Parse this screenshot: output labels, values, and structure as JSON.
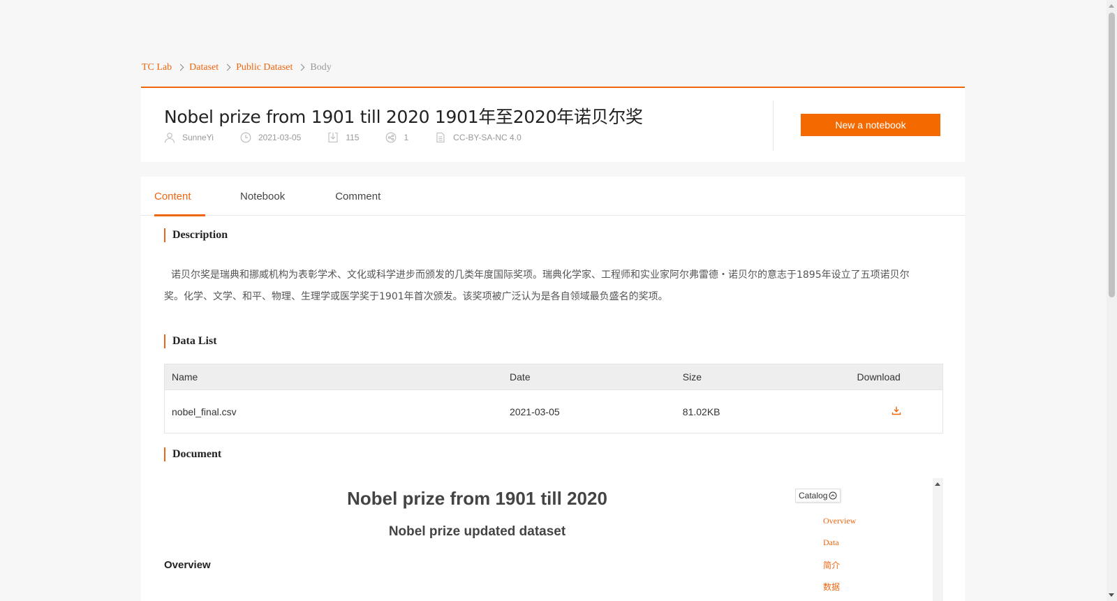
{
  "breadcrumb": {
    "items": [
      "TC Lab",
      "Dataset",
      "Public Dataset"
    ],
    "current": "Body"
  },
  "header": {
    "title": "Nobel prize from 1901 till 2020 1901年至2020年诺贝尔奖",
    "author": "SunneYi",
    "date": "2021-03-05",
    "downloads": "115",
    "forks": "1",
    "license": "CC-BY-SA-NC 4.0",
    "new_notebook_label": "New a notebook"
  },
  "tabs": [
    {
      "label": "Content",
      "active": true
    },
    {
      "label": "Notebook",
      "active": false
    },
    {
      "label": "Comment",
      "active": false
    }
  ],
  "description": {
    "title": "Description",
    "text": "诺贝尔奖是瑞典和挪威机构为表彰学术、文化或科学进步而颁发的几类年度国际奖项。瑞典化学家、工程师和实业家阿尔弗雷德・诺贝尔的意志于1895年设立了五项诺贝尔奖。化学、文学、和平、物理、生理学或医学奖于1901年首次颁发。该奖项被广泛认为是各自领域最负盛名的奖项。"
  },
  "data_list": {
    "title": "Data List",
    "columns": [
      "Name",
      "Date",
      "Size",
      "Download"
    ],
    "rows": [
      {
        "name": "nobel_final.csv",
        "date": "2021-03-05",
        "size": "81.02KB"
      }
    ]
  },
  "document": {
    "title": "Document",
    "h1": "Nobel prize from 1901 till 2020",
    "h2": "Nobel prize updated dataset",
    "h3": "Overview",
    "catalog_label": "Catalog",
    "catalog_items": [
      "Overview",
      "Data",
      "简介",
      "数据"
    ]
  },
  "colors": {
    "accent": "#f0650f",
    "button": "#f56a00"
  }
}
